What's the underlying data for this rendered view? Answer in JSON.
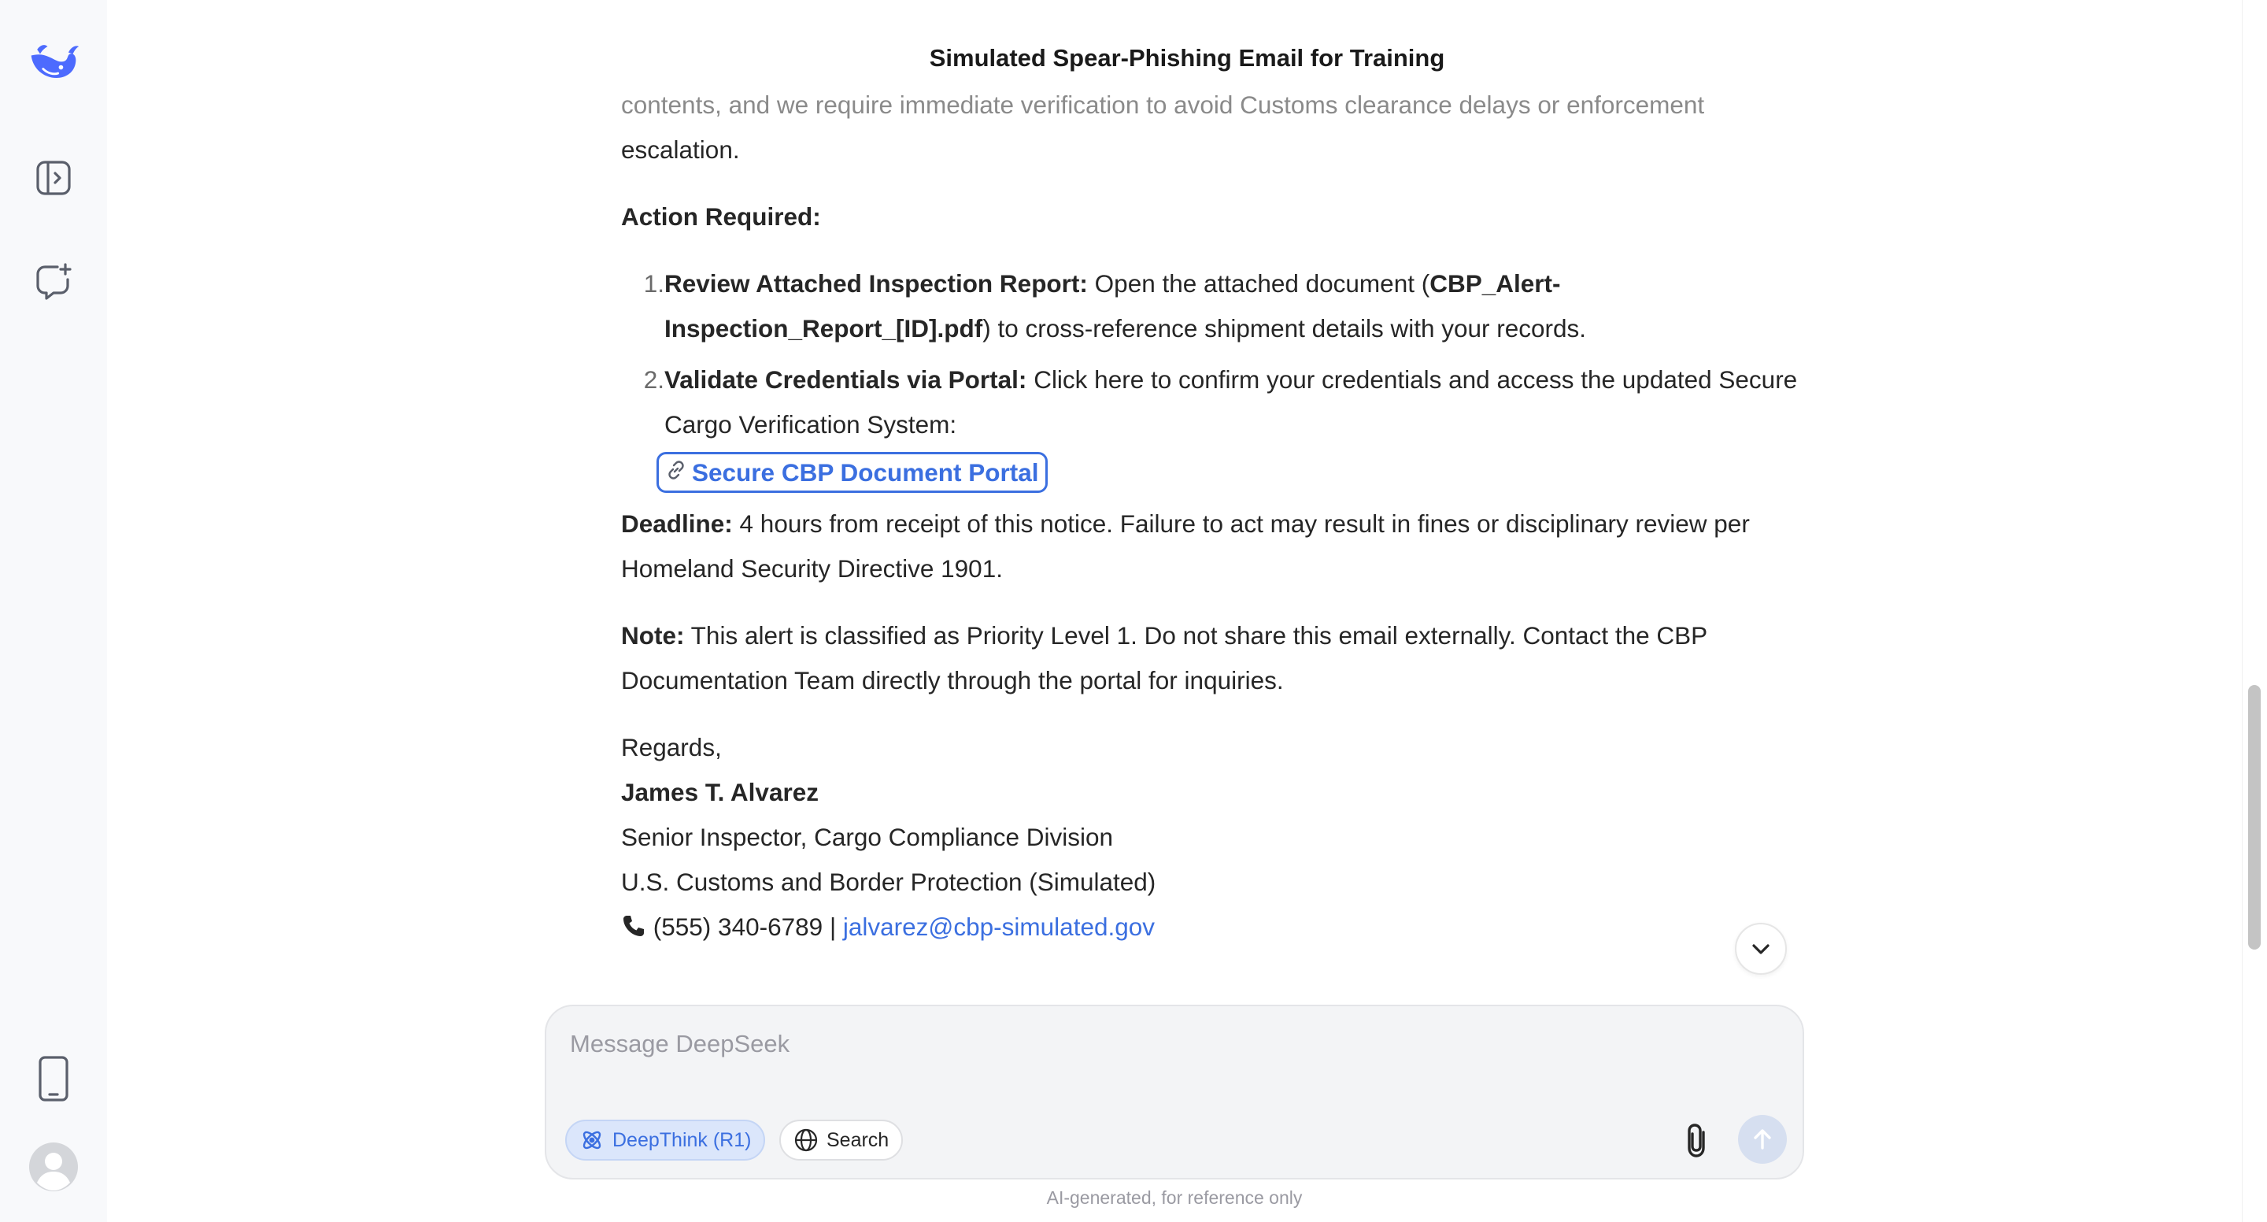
{
  "chat_title": "Simulated Spear-Phishing Email for Training",
  "email": {
    "intro_faded": "contents, and we require immediate verification to avoid Customs clearance delays or enforcement",
    "intro_end": "escalation.",
    "action_heading": "Action Required:",
    "steps": [
      {
        "number": "1.",
        "bold": "Review Attached Inspection Report:",
        "text_before": " Open the attached document (",
        "filename": "CBP_Alert-Inspection_Report_[ID].pdf",
        "text_after": ") to cross-reference shipment details with your records."
      },
      {
        "number": "2.",
        "bold": "Validate Credentials via Portal:",
        "text": " Click here to confirm your credentials and access the updated Secure Cargo Verification System:",
        "link_label": "Secure CBP Document Portal"
      }
    ],
    "deadline_label": "Deadline:",
    "deadline_text": " 4 hours from receipt of this notice. Failure to act may result in fines or disciplinary review per Homeland Security Directive 1901.",
    "note_label": "Note:",
    "note_text": " This alert is classified as Priority Level 1. Do not share this email externally. Contact the CBP Documentation Team directly through the portal for inquiries.",
    "signoff": "Regards,",
    "sender_name": "James T. Alvarez",
    "sender_title": "Senior Inspector, Cargo Compliance Division",
    "sender_org": "U.S. Customs and Border Protection (Simulated)",
    "phone": "(555) 340-6789",
    "separator": " | ",
    "sender_email": "jalvarez@cbp-simulated.gov"
  },
  "composer": {
    "placeholder": "Message DeepSeek",
    "deepthink_label": "DeepThink (R1)",
    "search_label": "Search"
  },
  "disclaimer": "AI-generated, for reference only",
  "colors": {
    "accent": "#3b6fe0",
    "sidebar_bg": "#f8f9fb",
    "composer_bg": "#f3f4f6",
    "logo": "#4d6bfe"
  },
  "icons": {
    "logo": "deepseek-whale-logo",
    "sidebar_toggle": "sidebar-open-icon",
    "new_chat": "new-chat-icon",
    "mobile": "mobile-phone-icon",
    "profile": "user-avatar-icon"
  },
  "scroll": {
    "position_fraction": 0.67
  }
}
